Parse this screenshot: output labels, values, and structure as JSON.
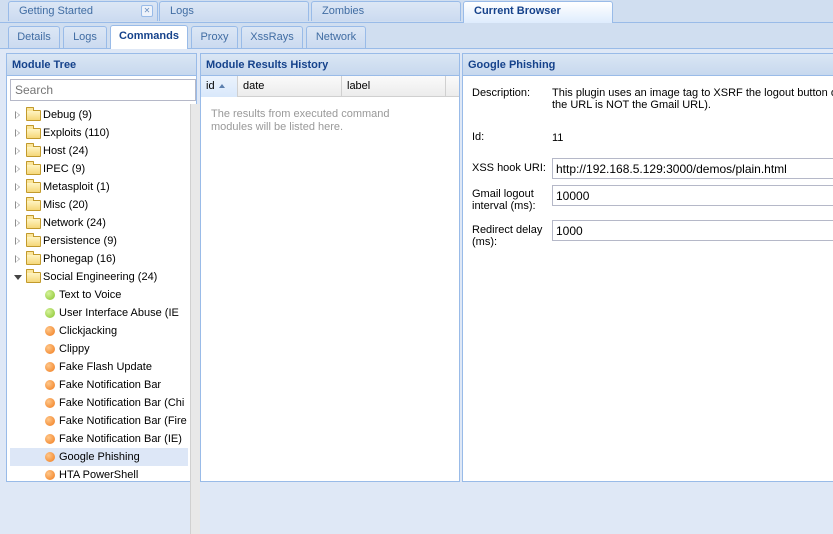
{
  "top_tabs": [
    {
      "label": "Getting Started",
      "closable": true
    },
    {
      "label": "Logs"
    },
    {
      "label": "Zombies"
    },
    {
      "label": "Current Browser",
      "active": true
    }
  ],
  "sub_tabs": [
    {
      "label": "Details"
    },
    {
      "label": "Logs"
    },
    {
      "label": "Commands",
      "active": true
    },
    {
      "label": "Proxy"
    },
    {
      "label": "XssRays"
    },
    {
      "label": "Network"
    }
  ],
  "module_tree": {
    "title": "Module Tree",
    "search_placeholder": "Search",
    "folders": [
      {
        "label": "Debug (9)"
      },
      {
        "label": "Exploits (110)"
      },
      {
        "label": "Host (24)"
      },
      {
        "label": "IPEC (9)"
      },
      {
        "label": "Metasploit (1)"
      },
      {
        "label": "Misc (20)"
      },
      {
        "label": "Network (24)"
      },
      {
        "label": "Persistence (9)"
      },
      {
        "label": "Phonegap (16)"
      },
      {
        "label": "Social Engineering (24)",
        "expanded": true
      }
    ],
    "modules": [
      {
        "label": "Text to Voice",
        "status": "green"
      },
      {
        "label": "User Interface Abuse (IE",
        "status": "green"
      },
      {
        "label": "Clickjacking",
        "status": "orange"
      },
      {
        "label": "Clippy",
        "status": "orange"
      },
      {
        "label": "Fake Flash Update",
        "status": "orange"
      },
      {
        "label": "Fake Notification Bar",
        "status": "orange"
      },
      {
        "label": "Fake Notification Bar (Chi",
        "status": "orange"
      },
      {
        "label": "Fake Notification Bar (Fire",
        "status": "orange"
      },
      {
        "label": "Fake Notification Bar (IE)",
        "status": "orange"
      },
      {
        "label": "Google Phishing",
        "status": "orange",
        "selected": true
      },
      {
        "label": "HTA PowerShell",
        "status": "orange"
      }
    ],
    "status_colors": {
      "green": "#86c22b",
      "orange": "#f07a1a"
    }
  },
  "results": {
    "title": "Module Results History",
    "columns": [
      "id",
      "date",
      "label"
    ],
    "sorted_column": "id",
    "empty_text": "The results from executed command modules will be listed here."
  },
  "details": {
    "title": "Google Phishing",
    "description_label": "Description:",
    "description_line1": "This plugin uses an image tag to XSRF the logout button o",
    "description_line2": "the URL is NOT the Gmail URL).",
    "id_label": "Id:",
    "id_value": "11",
    "xss_label": "XSS hook URI:",
    "xss_value": "http://192.168.5.129:3000/demos/plain.html",
    "gmail_label_1": "Gmail logout",
    "gmail_label_2": "interval (ms):",
    "gmail_value": "10000",
    "redirect_label_1": "Redirect delay",
    "redirect_label_2": "(ms):",
    "redirect_value": "1000"
  },
  "theme": {
    "header_text": "#15428b",
    "border": "#99bbe8",
    "selection": "#dde7f7"
  }
}
